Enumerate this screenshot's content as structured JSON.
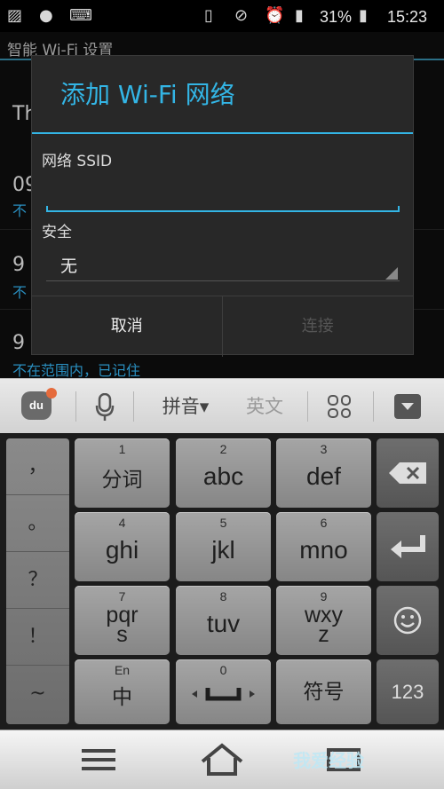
{
  "status_bar": {
    "battery_percent": "31%",
    "time": "15:23"
  },
  "background": {
    "title": "智能 Wi-Fi 设置",
    "rows": [
      "Th",
      "09",
      "9",
      "9"
    ],
    "subs": [
      "不",
      "不",
      "不在范围内，已记住"
    ]
  },
  "dialog": {
    "title": "添加 Wi-Fi 网络",
    "ssid_label": "网络 SSID",
    "ssid_value": "",
    "security_label": "安全",
    "security_value": "无",
    "cancel_label": "取消",
    "connect_label": "连接"
  },
  "keyboard": {
    "toolbar": {
      "logo_text": "du",
      "pinyin_label": "拼音▾",
      "english_label": "英文"
    },
    "punctuation": [
      "，",
      "。",
      "？",
      "！",
      "~"
    ],
    "keys": [
      {
        "num": "1",
        "label": "分词"
      },
      {
        "num": "2",
        "label": "abc"
      },
      {
        "num": "3",
        "label": "def"
      },
      {
        "num": "4",
        "label": "ghi"
      },
      {
        "num": "5",
        "label": "jkl"
      },
      {
        "num": "6",
        "label": "mno"
      },
      {
        "num": "7",
        "label": "pqr\ns"
      },
      {
        "num": "8",
        "label": "tuv"
      },
      {
        "num": "9",
        "label": "wxy\nz"
      },
      {
        "num": "En",
        "label": "中"
      },
      {
        "num": "0",
        "label": ""
      },
      {
        "num": "",
        "label": "符号"
      }
    ],
    "numeric_key_label": "123"
  },
  "watermark": "我爱经验"
}
